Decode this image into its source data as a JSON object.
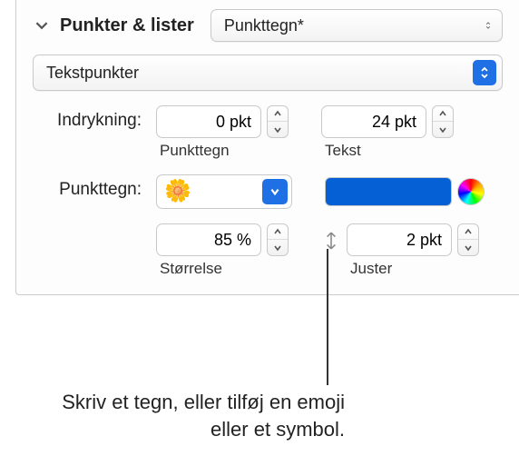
{
  "header": {
    "title": "Punkter & lister",
    "style_label": "Punkttegn*"
  },
  "type_select": {
    "label": "Tekstpunkter"
  },
  "indent": {
    "label": "Indrykning:",
    "bullet": {
      "value": "0 pkt",
      "sublabel": "Punkttegn"
    },
    "text": {
      "value": "24 pkt",
      "sublabel": "Tekst"
    }
  },
  "bullet": {
    "label": "Punkttegn:",
    "emoji": "🌼",
    "color": "#0560d6"
  },
  "size_align": {
    "size": {
      "value": "85 %",
      "sublabel": "Størrelse"
    },
    "align": {
      "value": "2 pkt",
      "sublabel": "Juster"
    }
  },
  "callout": "Skriv et tegn, eller tilføj en emoji eller et symbol."
}
